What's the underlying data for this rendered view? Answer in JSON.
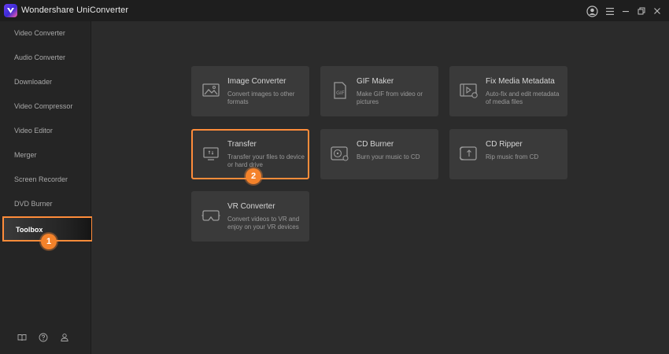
{
  "app": {
    "title": "Wondershare UniConverter"
  },
  "sidebar": {
    "items": [
      {
        "label": "Video Converter"
      },
      {
        "label": "Audio Converter"
      },
      {
        "label": "Downloader"
      },
      {
        "label": "Video Compressor"
      },
      {
        "label": "Video Editor"
      },
      {
        "label": "Merger"
      },
      {
        "label": "Screen Recorder"
      },
      {
        "label": "DVD Burner"
      },
      {
        "label": "Toolbox",
        "active": true
      }
    ],
    "footer_icons": [
      "book-icon",
      "help-icon",
      "user-group-icon"
    ]
  },
  "toolbox": {
    "cards": [
      {
        "title": "Image Converter",
        "description": "Convert images to other formats",
        "icon": "image-icon"
      },
      {
        "title": "GIF Maker",
        "description": "Make GIF from video or pictures",
        "icon": "gif-icon"
      },
      {
        "title": "Fix Media Metadata",
        "description": "Auto-fix and edit metadata of media files",
        "icon": "metadata-icon"
      },
      {
        "title": "Transfer",
        "description": "Transfer your files to device or hard drive",
        "icon": "transfer-icon",
        "highlighted": true
      },
      {
        "title": "CD Burner",
        "description": "Burn your music to CD",
        "icon": "cd-burn-icon"
      },
      {
        "title": "CD Ripper",
        "description": "Rip music from CD",
        "icon": "cd-rip-icon"
      },
      {
        "title": "VR Converter",
        "description": "Convert videos to VR and enjoy on your VR devices",
        "icon": "vr-icon"
      }
    ]
  },
  "markers": [
    {
      "label": "1"
    },
    {
      "label": "2"
    }
  ],
  "colors": {
    "highlight": "#ff8c3a",
    "marker": "#f4822a",
    "card_bg": "#3a3a3a",
    "main_bg": "#2b2b2b"
  }
}
